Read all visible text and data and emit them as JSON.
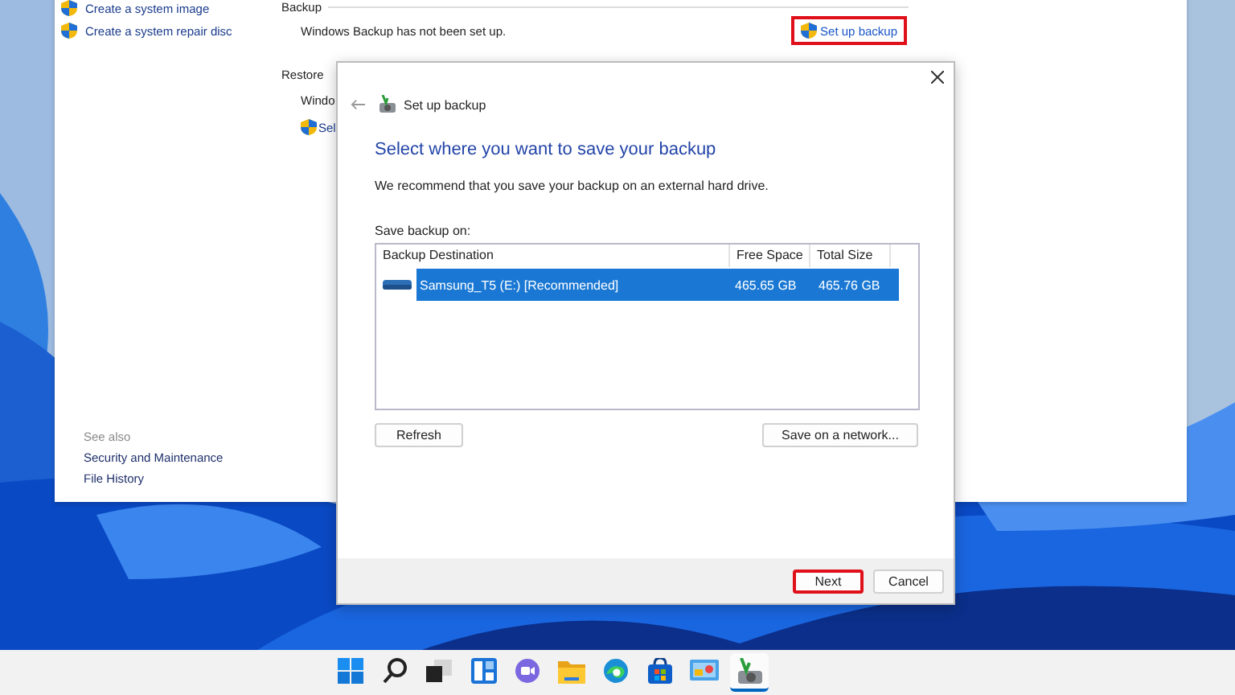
{
  "control_panel": {
    "sidebar_links": [
      {
        "label": "Create a system image"
      },
      {
        "label": "Create a system repair disc"
      }
    ],
    "see_also": {
      "heading": "See also",
      "links": [
        {
          "label": "Security and Maintenance"
        },
        {
          "label": "File History"
        }
      ]
    },
    "backup": {
      "heading": "Backup",
      "status": "Windows Backup has not been set up.",
      "action": {
        "label": "Set up backup",
        "highlighted": true
      }
    },
    "restore": {
      "heading": "Restore",
      "status": "Windo",
      "action": "Sel"
    }
  },
  "dialog": {
    "title": "Set up backup",
    "heading": "Select where you want to save your backup",
    "description": "We recommend that you save your backup on an external hard drive.",
    "list_label": "Save backup on:",
    "table": {
      "columns": [
        "Backup Destination",
        "Free Space",
        "Total Size"
      ],
      "rows": [
        {
          "cells": [
            "Samsung_T5 (E:) [Recommended]",
            "465.65 GB",
            "465.76 GB"
          ],
          "selected": true
        }
      ]
    },
    "buttons": [
      {
        "label": "Refresh"
      },
      {
        "label": "Save on a network..."
      }
    ],
    "footer_buttons": [
      {
        "label": "Next",
        "highlighted": true
      },
      {
        "label": "Cancel",
        "highlighted": false
      }
    ]
  },
  "taskbar": {
    "apps": [
      {
        "kind": "start",
        "active": false
      },
      {
        "kind": "search",
        "active": false
      },
      {
        "kind": "task-view",
        "active": false
      },
      {
        "kind": "widgets",
        "active": false
      },
      {
        "kind": "chat",
        "active": false
      },
      {
        "kind": "explorer",
        "active": false
      },
      {
        "kind": "edge",
        "active": false
      },
      {
        "kind": "store",
        "active": false
      },
      {
        "kind": "control-panel",
        "active": false
      },
      {
        "kind": "backup",
        "active": true
      }
    ]
  }
}
